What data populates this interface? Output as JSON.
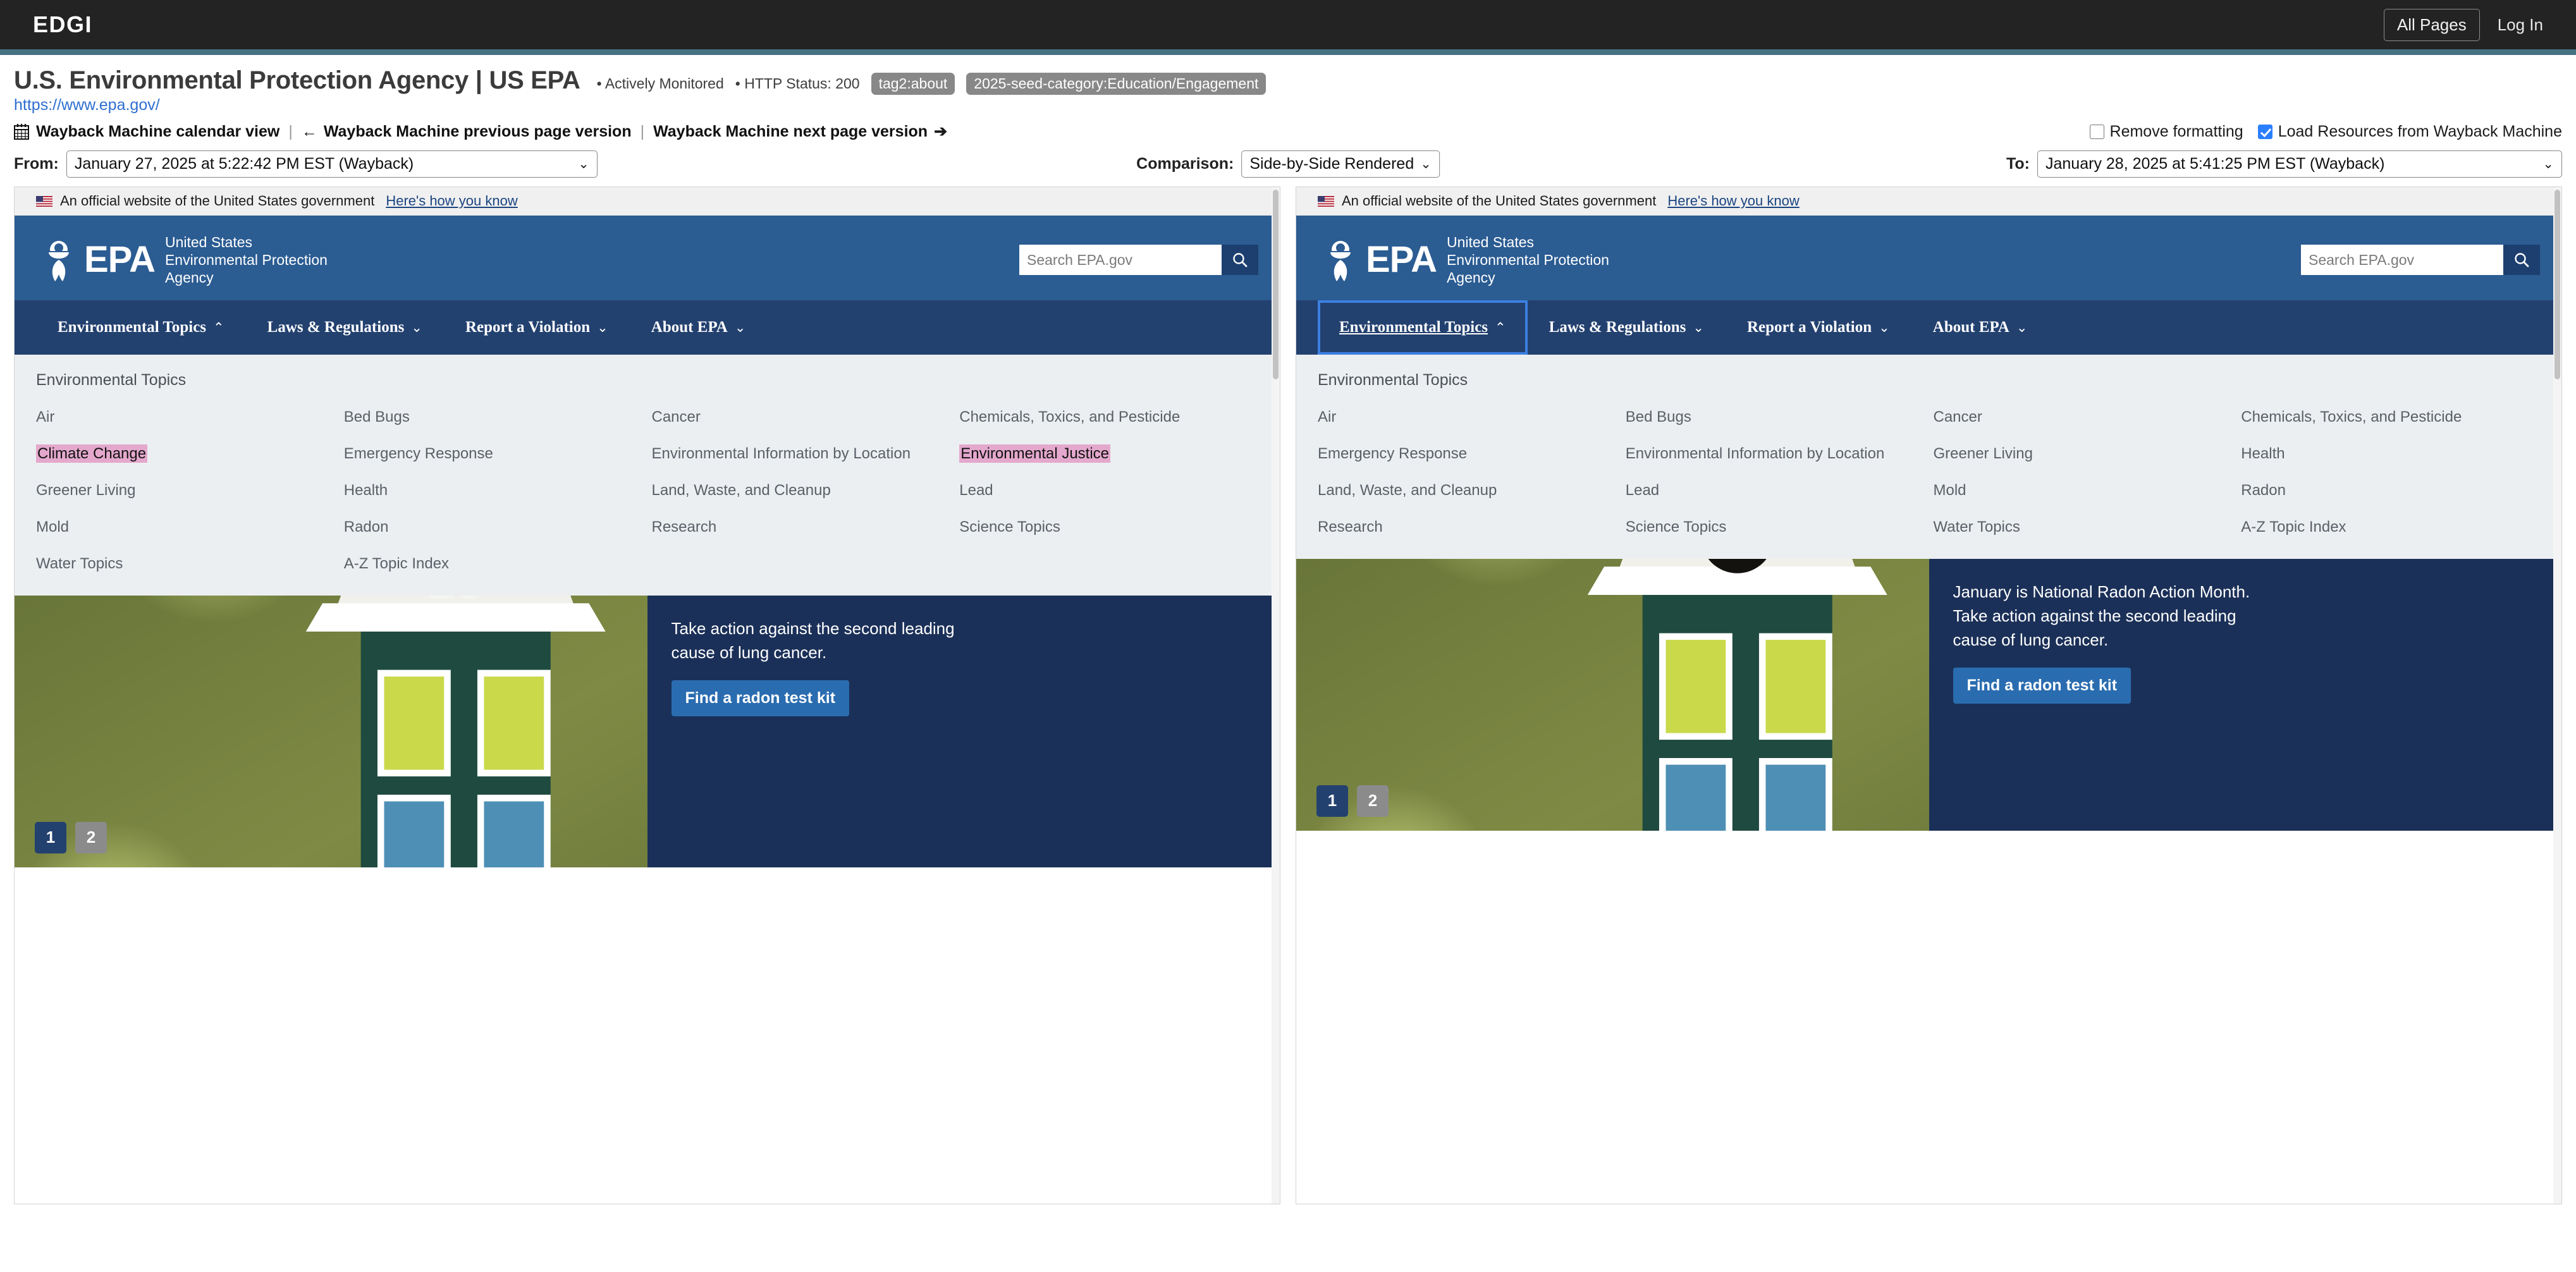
{
  "appbar": {
    "brand": "EDGI",
    "all_pages_label": "All Pages",
    "login_label": "Log In",
    "accent_color": "#477284",
    "background_color": "#232323"
  },
  "page": {
    "title": "U.S. Environmental Protection Agency | US EPA",
    "url": "https://www.epa.gov/",
    "monitor_status": "• Actively Monitored",
    "http_status": "• HTTP Status: 200",
    "badges": [
      "tag2:about",
      "2025-seed-category:Education/Engagement"
    ],
    "badge_color": "#888888",
    "url_color": "#2f6fd0"
  },
  "wayback": {
    "calendar_icon": "calendar-icon",
    "calendar_link": "Wayback Machine calendar view",
    "prev_arrow": "←",
    "prev_link": "Wayback Machine previous page version",
    "next_link": "Wayback Machine next page version",
    "next_arrow": "➔",
    "separator": "|",
    "remove_formatting_label": "Remove formatting",
    "remove_formatting_checked": false,
    "load_resources_label": "Load Resources from Wayback Machine",
    "load_resources_checked": true,
    "checkbox_accent": "#2b7fff"
  },
  "controls": {
    "from_label": "From:",
    "from_value": "January 27, 2025 at 5:22:42 PM EST (Wayback)",
    "comparison_label": "Comparison:",
    "comparison_value": "Side-by-Side Rendered",
    "to_label": "To:",
    "to_value": "January 28, 2025 at 5:41:25 PM EST (Wayback)",
    "caret": "⌄"
  },
  "diff": {
    "highlight_removed_color": "#e4a8cd",
    "focus_outline_color": "#3c7fe0"
  },
  "epa": {
    "gov_banner_text": "An official website of the United States government",
    "gov_banner_link": "Here's how you know",
    "logo_word": "EPA",
    "agency_line1": "United States",
    "agency_line2": "Environmental Protection",
    "agency_line3": "Agency",
    "search_placeholder": "Search EPA.gov",
    "search_value": "",
    "header_color": "#2b5c92",
    "nav_color": "#23416f",
    "nav": [
      {
        "label": "Environmental Topics",
        "chevron": "⌃"
      },
      {
        "label": "Laws & Regulations",
        "chevron": "⌄"
      },
      {
        "label": "Report a Violation",
        "chevron": "⌄"
      },
      {
        "label": "About EPA",
        "chevron": "⌄"
      }
    ],
    "mega_title": "Environmental Topics",
    "hero": {
      "line1": "January is National Radon Action Month.",
      "line2": "Take action against the second leading",
      "line3": "cause of lung cancer.",
      "button_label": "Find a radon test kit",
      "pager": [
        "1",
        "2"
      ],
      "panel_color": "#1b3058",
      "button_color": "#2a6cb0"
    }
  },
  "left_pane": {
    "topics": [
      {
        "label": "Air",
        "removed": false
      },
      {
        "label": "Bed Bugs",
        "removed": false
      },
      {
        "label": "Cancer",
        "removed": false
      },
      {
        "label": "Chemicals, Toxics, and Pesticide",
        "removed": false
      },
      {
        "label": "Climate Change",
        "removed": true
      },
      {
        "label": "Emergency Response",
        "removed": false
      },
      {
        "label": "Environmental Information by Location",
        "removed": false
      },
      {
        "label": "Environmental Justice",
        "removed": true
      },
      {
        "label": "Greener Living",
        "removed": false
      },
      {
        "label": "Health",
        "removed": false
      },
      {
        "label": "Land, Waste, and Cleanup",
        "removed": false
      },
      {
        "label": "Lead",
        "removed": false
      },
      {
        "label": "Mold",
        "removed": false
      },
      {
        "label": "Radon",
        "removed": false
      },
      {
        "label": "Research",
        "removed": false
      },
      {
        "label": "Science Topics",
        "removed": false
      },
      {
        "label": "Water Topics",
        "removed": false
      },
      {
        "label": "A-Z Topic Index",
        "removed": false
      }
    ]
  },
  "right_pane": {
    "topics": [
      {
        "label": "Air",
        "removed": false
      },
      {
        "label": "Bed Bugs",
        "removed": false
      },
      {
        "label": "Cancer",
        "removed": false
      },
      {
        "label": "Chemicals, Toxics, and Pesticide",
        "removed": false
      },
      {
        "label": "Emergency Response",
        "removed": false
      },
      {
        "label": "Environmental Information by Location",
        "removed": false
      },
      {
        "label": "Greener Living",
        "removed": false
      },
      {
        "label": "Health",
        "removed": false
      },
      {
        "label": "Land, Waste, and Cleanup",
        "removed": false
      },
      {
        "label": "Lead",
        "removed": false
      },
      {
        "label": "Mold",
        "removed": false
      },
      {
        "label": "Radon",
        "removed": false
      },
      {
        "label": "Research",
        "removed": false
      },
      {
        "label": "Science Topics",
        "removed": false
      },
      {
        "label": "Water Topics",
        "removed": false
      },
      {
        "label": "A-Z Topic Index",
        "removed": false
      }
    ]
  }
}
